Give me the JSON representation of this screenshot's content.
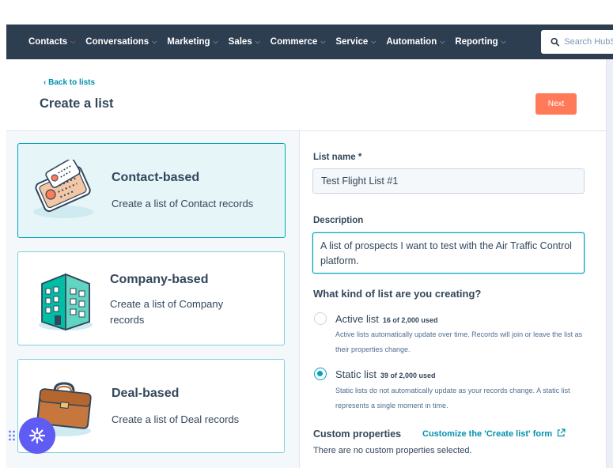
{
  "nav": {
    "items": [
      {
        "label": "Contacts",
        "active": true
      },
      {
        "label": "Conversations"
      },
      {
        "label": "Marketing"
      },
      {
        "label": "Sales"
      },
      {
        "label": "Commerce"
      },
      {
        "label": "Service"
      },
      {
        "label": "Automation"
      },
      {
        "label": "Reporting"
      }
    ],
    "search_placeholder": "Search HubSpot"
  },
  "header": {
    "back_label": "‹ Back to lists",
    "title": "Create a list",
    "next_label": "Next"
  },
  "list_types": [
    {
      "title": "Contact-based",
      "description": "Create a list of Contact records",
      "selected": true,
      "icon": "contact-card-icon"
    },
    {
      "title": "Company-based",
      "description": "Create a list of Company records",
      "selected": false,
      "icon": "building-icon"
    },
    {
      "title": "Deal-based",
      "description": "Create a list of Deal records",
      "selected": false,
      "icon": "briefcase-icon"
    }
  ],
  "form": {
    "list_name_label": "List name *",
    "list_name_value": "Test Flight List #1",
    "description_label": "Description",
    "description_value": "A list of prospects I want to test with the Air Traffic Control platform.",
    "question": "What kind of list are you creating?",
    "options": [
      {
        "label": "Active list",
        "usage": "16 of 2,000 used",
        "description": "Active lists automatically update over time. Records will join or leave the list as their properties change.",
        "selected": false
      },
      {
        "label": "Static list",
        "usage": "39 of 2,000 used",
        "description": "Static lists do not automatically update as your records change. A static list represents a single moment in time.",
        "selected": true
      }
    ],
    "custom_properties_title": "Custom properties",
    "custom_properties_link": "Customize the 'Create list' form",
    "custom_properties_empty": "There are no custom properties selected."
  },
  "colors": {
    "nav_bg": "#2d3e50",
    "accent_orange": "#ff7a59",
    "accent_teal": "#00a4bd",
    "helper_purple": "#5e5cf2"
  }
}
